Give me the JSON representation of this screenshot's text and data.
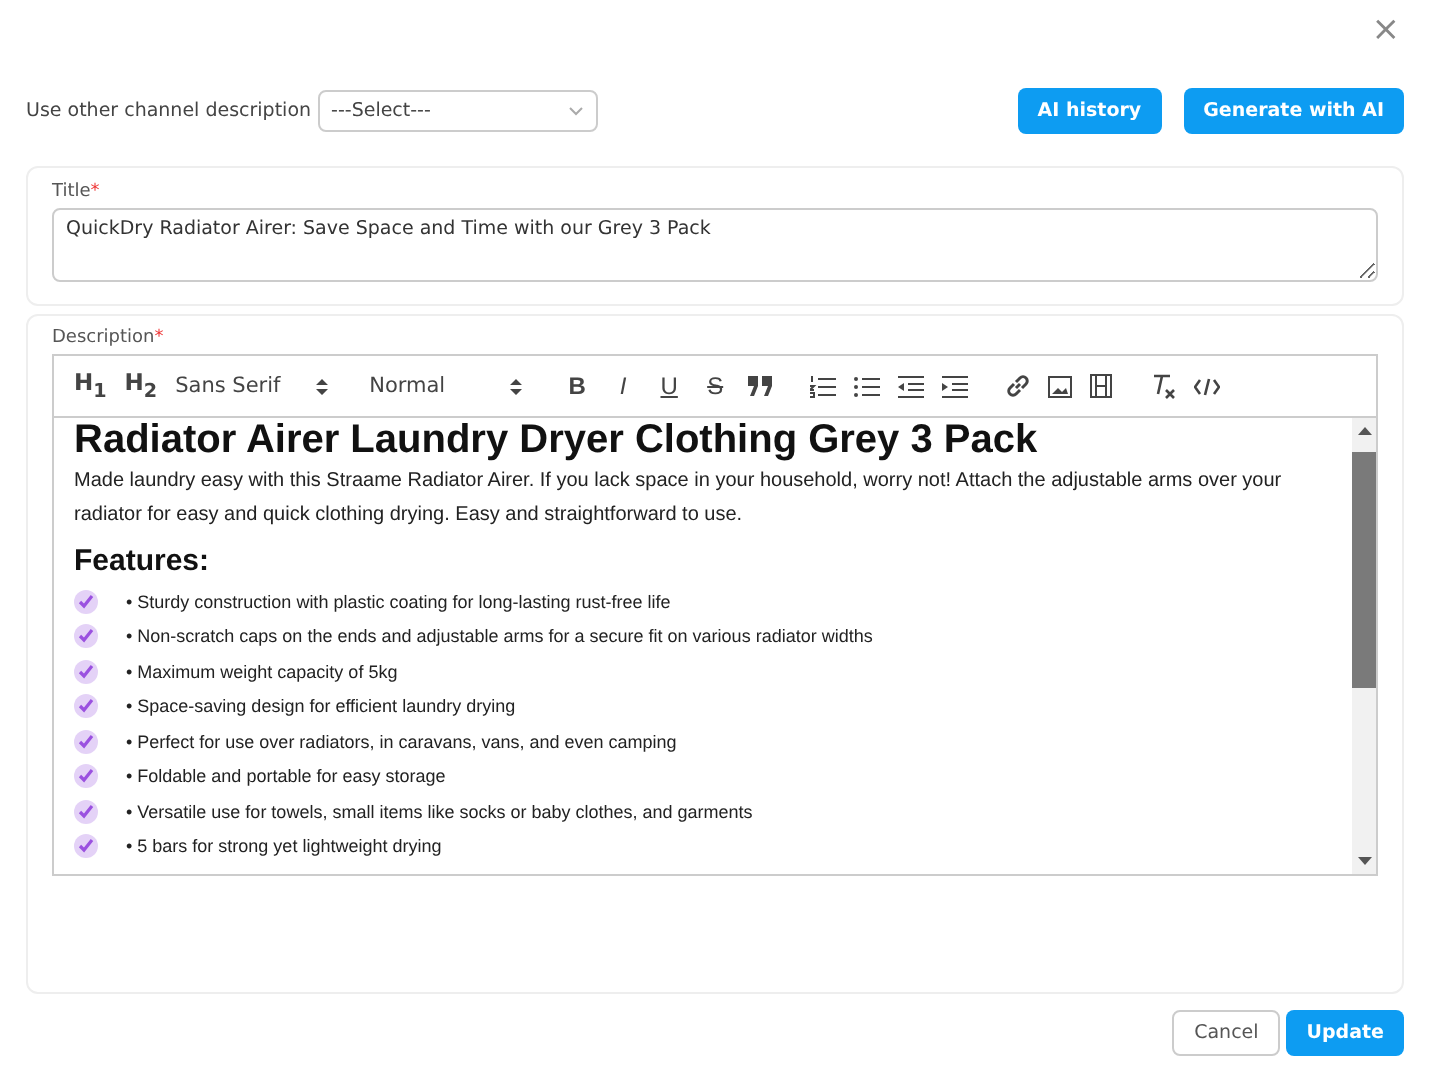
{
  "close_symbol": "×",
  "channel": {
    "label": "Use other channel description",
    "select_value": "---Select---"
  },
  "header_buttons": [
    "AI history",
    "Generate with AI"
  ],
  "title_field": {
    "label": "Title",
    "required_mark": "*",
    "value": "QuickDry Radiator Airer: Save Space and Time with our Grey 3 Pack"
  },
  "description": {
    "label": "Description",
    "required_mark": "*",
    "toolbar": {
      "headings": [
        "H$_{1}$",
        "H$_{2}$"
      ],
      "font": "Sans Serif",
      "size": "Normal",
      "format_letters": [
        {
          "text": "B",
          "kind": "bold"
        },
        {
          "text": "I",
          "kind": "italic"
        },
        {
          "text": "U",
          "kind": "underline"
        },
        {
          "text": "S",
          "kind": "strike"
        }
      ]
    },
    "heading": "Radiator Airer Laundry Dryer Clothing Grey 3 Pack",
    "intro": "Made laundry easy with this Straame Radiator Airer. If you lack space in your household, worry not! Attach the adjustable arms over your radiator for easy and quick clothing drying. Easy and straightforward to use.",
    "features_heading": "Features:",
    "features": [
      "• Sturdy construction with plastic coating for long-lasting rust-free life",
      "• Non-scratch caps on the ends and adjustable arms for a secure fit on various radiator widths",
      "• Maximum weight capacity of 5kg",
      "• Space-saving design for efficient laundry drying",
      "• Perfect for use over radiators, in caravans, vans, and even camping",
      "• Foldable and portable for easy storage",
      "• Versatile use for towels, small items like socks or baby clothes, and garments",
      "• 5 bars for strong yet lightweight drying"
    ]
  },
  "footer_buttons": [
    {
      "label": "Cancel",
      "kind": "secondary"
    },
    {
      "label": "Update",
      "kind": "primary"
    }
  ]
}
